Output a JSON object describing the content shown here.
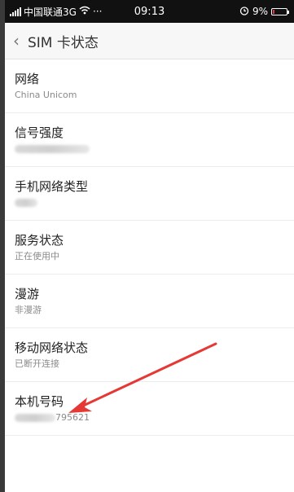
{
  "status_bar": {
    "carrier": "中国联通3G",
    "time": "09:13",
    "battery": "9%",
    "battery_level": 0.09,
    "icons": [
      "signal-icon",
      "wifi-icon",
      "more-icon",
      "alarm-icon",
      "battery-icon"
    ]
  },
  "header": {
    "back_label": "‹",
    "title": "SIM 卡状态"
  },
  "items": [
    {
      "title": "网络",
      "value": "China Unicom"
    },
    {
      "title": "信号强度",
      "value": ""
    },
    {
      "title": "手机网络类型",
      "value": ""
    },
    {
      "title": "服务状态",
      "value": "正在使用中"
    },
    {
      "title": "漫游",
      "value": "非漫游"
    },
    {
      "title": "移动网络状态",
      "value": "已断开连接"
    },
    {
      "title": "本机号码",
      "value": "795621"
    }
  ],
  "annotation": {
    "arrow_color": "#e53935"
  }
}
